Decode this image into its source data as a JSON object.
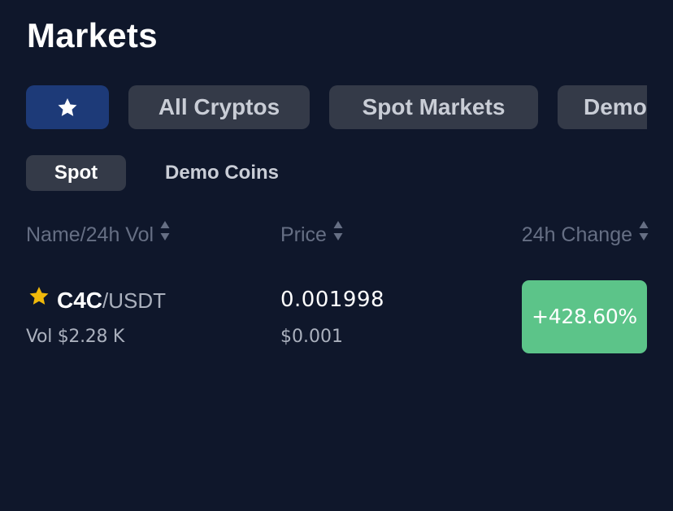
{
  "page": {
    "title": "Markets"
  },
  "category_tabs": [
    {
      "id": "favorites",
      "label": "",
      "icon": "star-icon",
      "active": true
    },
    {
      "id": "all-cryptos",
      "label": "All Cryptos",
      "active": false
    },
    {
      "id": "spot-markets",
      "label": "Spot Markets",
      "active": false
    },
    {
      "id": "demo",
      "label": "Demo Coins",
      "active": false
    }
  ],
  "sub_tabs": [
    {
      "id": "spot",
      "label": "Spot",
      "active": true
    },
    {
      "id": "demo-coins",
      "label": "Demo Coins",
      "active": false
    }
  ],
  "columns": {
    "name": "Name/24h Vol",
    "price": "Price",
    "change": "24h Change",
    "sort_icon": "sort-icon"
  },
  "rows": [
    {
      "favorited": true,
      "base": "C4C",
      "quote": "/USDT",
      "volume": "Vol $2.28 K",
      "price": "0.001998",
      "price_usd": "$0.001",
      "change": "+428.60%",
      "change_color": "#5cc489"
    }
  ],
  "colors": {
    "background": "#0f172b",
    "favorite_tab": "#1d3a78",
    "tab": "#343a48",
    "star": "#f0b90b",
    "positive": "#5cc489",
    "header_text": "#666f84"
  }
}
